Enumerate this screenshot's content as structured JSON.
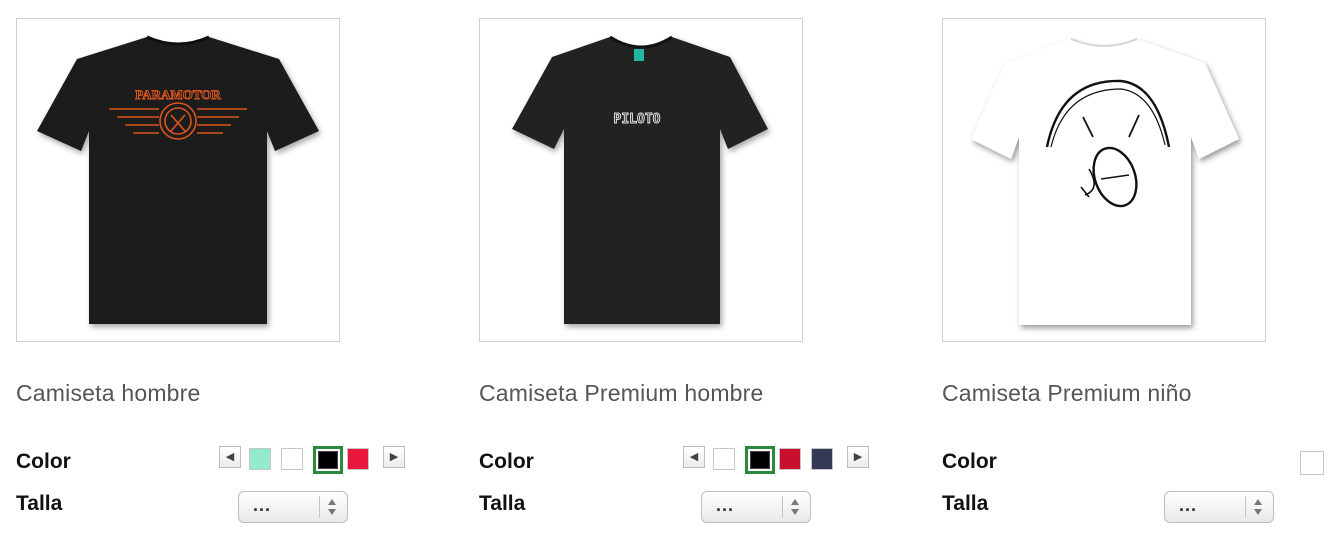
{
  "products": [
    {
      "name": "Camiseta hombre",
      "image_alt": "PARAMOTOR",
      "color_label": "Color",
      "size_label": "Talla",
      "size_value": "...",
      "swatch_colors": [
        "#93ebcb",
        "#ffffff",
        "#000000",
        "#e8173b"
      ],
      "selected_color": "#000000",
      "shirt_color": "#1c1c1c",
      "print_color": "#d9541c"
    },
    {
      "name": "Camiseta Premium hombre",
      "image_alt": "PILOTO",
      "color_label": "Color",
      "size_label": "Talla",
      "size_value": "...",
      "swatch_colors": [
        "#ffffff",
        "#000000",
        "#c8102e",
        "#343a55"
      ],
      "selected_color": "#000000",
      "shirt_color": "#232323",
      "label_tag_color": "#1fb7a3"
    },
    {
      "name": "Camiseta Premium niño",
      "color_label": "Color",
      "size_label": "Talla",
      "size_value": "...",
      "swatch_colors": [
        "#ffffff"
      ],
      "shirt_color": "#ffffff"
    }
  ],
  "icons": {
    "prev": "chevron-left-icon",
    "next": "chevron-right-icon",
    "stepper": "up-down-stepper-icon"
  },
  "arrows": {
    "left": "◀",
    "right": "▶"
  }
}
